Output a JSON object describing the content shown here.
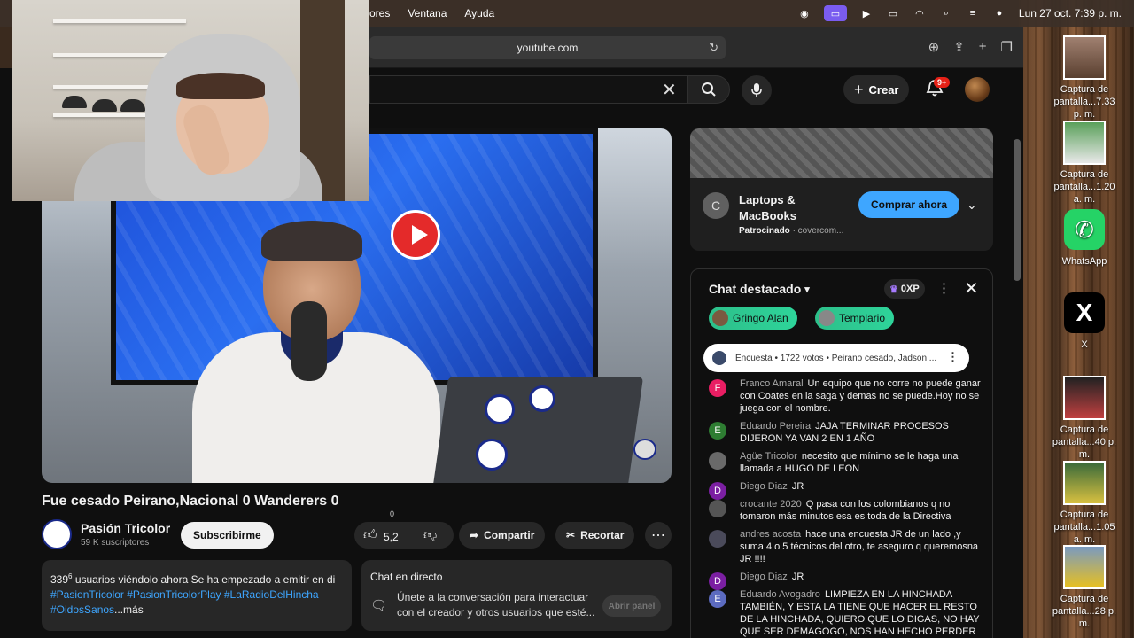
{
  "menubar": {
    "menus": [
      "ores",
      "Ventana",
      "Ayuda"
    ],
    "clock": "Lun 27 oct.  7:39 p. m."
  },
  "browser": {
    "url": "youtube.com"
  },
  "youtube": {
    "header": {
      "create_label": "Crear",
      "notif_badge": "9+"
    },
    "video": {
      "title": "Fue cesado Peirano,Nacional 0 Wanderers 0",
      "channel_name": "Pasión Tricolor",
      "subscribers": "59 K suscriptores",
      "subscribe_label": "Subscribirme",
      "like_count": "5,2",
      "like_top": "0",
      "share_label": "Compartir",
      "clip_label": "Recortar"
    },
    "description": {
      "stats_count": "339",
      "stats_sup": "6",
      "stats_rest": " usuarios viéndolo ahora  Se ha empezado a emitir en di",
      "hashtags": "#PasionTricolor #PasionTricolorPlay #LaRadioDelHincha",
      "hashtag_last": "#OidosSanos",
      "more": "...más"
    },
    "live_chat_box": {
      "title": "Chat en directo",
      "text": "Únete a la conversación para interactuar con el creador y otros usuarios que esté...",
      "button": "Abrir panel"
    },
    "ad": {
      "logo_letter": "C",
      "title": "Laptops & MacBooks",
      "sponsor_label": "Patrocinado",
      "sponsor_domain": "  ·  covercom...",
      "cta": "Comprar ahora"
    },
    "chat": {
      "header": "Chat destacado",
      "xp": "0XP",
      "chips": [
        "Gringo Alan",
        "Templario"
      ],
      "poll": "Encuesta • 1722 votos • Peirano cesado, Jadson ...",
      "messages": [
        {
          "initial": "F",
          "color": "#e91e63",
          "author": "Franco Amaral",
          "text": "Un equipo que no corre no puede ganar con Coates en la saga y demas no se puede.Hoy no se juega con el nombre."
        },
        {
          "initial": "E",
          "color": "#2e7d32",
          "author": "Eduardo Pereira",
          "text": "JAJA TERMINAR PROCESOS DIJERON YA VAN 2 EN 1 AÑO"
        },
        {
          "initial": "",
          "color": "#6a6a6a",
          "author": "Agüe Tricolor",
          "text": "necesito que mínimo se le haga una llamada a HUGO DE LEON"
        },
        {
          "initial": "D",
          "color": "#7b1fa2",
          "author": "Diego Diaz",
          "text": "JR"
        },
        {
          "initial": "",
          "color": "#555555",
          "author": "crocante 2020",
          "text": "Q pasa con los colombianos q no tomaron más minutos esa es toda de la Directiva"
        },
        {
          "initial": "",
          "color": "#4a4a5a",
          "author": "andres acosta",
          "text": "hace una encuesta JR de un lado ,y suma 4 o 5 técnicos del otro, te aseguro q queremosna JR !!!!"
        },
        {
          "initial": "D",
          "color": "#7b1fa2",
          "author": "Diego Diaz",
          "text": "JR"
        },
        {
          "initial": "E",
          "color": "#5c6bc0",
          "author": "Eduardo Avogadro",
          "text": "LIMPIEZA EN LA HINCHADA TAMBIÉN, Y ESTA LA TIENE QUE HACER EL RESTO DE LA HINCHADA, QUIERO QUE LO DIGAS, NO HAY QUE SER DEMAGOGO, NOS HAN HECHO PERDER"
        }
      ]
    }
  },
  "desktop": {
    "icons": [
      {
        "label1": "Captura de",
        "label2": "pantalla...7.33 p. m."
      },
      {
        "label1": "Captura de",
        "label2": "pantalla...1.20 a. m."
      },
      {
        "label1": "WhatsApp",
        "label2": ""
      },
      {
        "label1": "X",
        "label2": ""
      },
      {
        "label1": "Captura de",
        "label2": "pantalla...40 p. m."
      },
      {
        "label1": "Captura de",
        "label2": "pantalla...1.05 a. m."
      },
      {
        "label1": "Captura de",
        "label2": "pantalla...28 p. m."
      }
    ]
  }
}
